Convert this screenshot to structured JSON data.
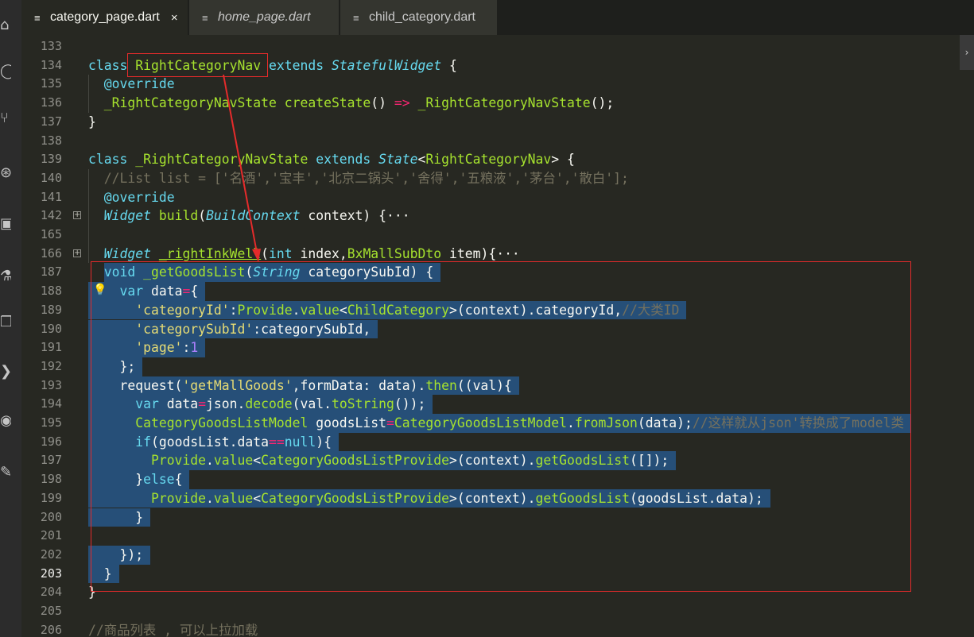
{
  "activity_bar": {
    "icons": [
      "files-icon",
      "search-icon",
      "source-control-icon",
      "debug-icon",
      "extensions-icon",
      "test-icon",
      "copy-icon",
      "run-icon",
      "settings-icon",
      "tools-icon"
    ]
  },
  "tabs": [
    {
      "label": "category_page.dart",
      "icon": "file-icon",
      "active": true,
      "close": "×"
    },
    {
      "label": "home_page.dart",
      "icon": "file-icon",
      "active": false,
      "italic": true
    },
    {
      "label": "child_category.dart",
      "icon": "file-icon",
      "active": false
    }
  ],
  "editor": {
    "lines": [
      {
        "no": "133",
        "code": ""
      },
      {
        "no": "134",
        "code": "class RightCategoryNav extends StatefulWidget {"
      },
      {
        "no": "135",
        "code": "  @override"
      },
      {
        "no": "136",
        "code": "  _RightCategoryNavState createState() => _RightCategoryNavState();"
      },
      {
        "no": "137",
        "code": "}"
      },
      {
        "no": "138",
        "code": ""
      },
      {
        "no": "139",
        "code": "class _RightCategoryNavState extends State<RightCategoryNav> {"
      },
      {
        "no": "140",
        "code": "  //List list = ['名酒','宝丰','北京二锅头','舍得','五粮液','茅台','散白'];"
      },
      {
        "no": "141",
        "code": "  @override"
      },
      {
        "no": "142",
        "code": "  Widget build(BuildContext context) {···",
        "fold": true
      },
      {
        "no": "165",
        "code": ""
      },
      {
        "no": "166",
        "code": "  Widget _rightInkWell(int index,BxMallSubDto item){···",
        "fold": true
      },
      {
        "no": "187",
        "code": "  void _getGoodsList(String categorySubId) {"
      },
      {
        "no": "188",
        "code": "    var data={"
      },
      {
        "no": "189",
        "code": "      'categoryId':Provide.value<ChildCategory>(context).categoryId,//大类ID"
      },
      {
        "no": "190",
        "code": "      'categorySubId':categorySubId,"
      },
      {
        "no": "191",
        "code": "      'page':1"
      },
      {
        "no": "192",
        "code": "    };"
      },
      {
        "no": "193",
        "code": "    request('getMallGoods',formData: data).then((val){"
      },
      {
        "no": "194",
        "code": "      var data=json.decode(val.toString());"
      },
      {
        "no": "195",
        "code": "      CategoryGoodsListModel goodsList=CategoryGoodsListModel.fromJson(data);//这样就从json'转换成了model类"
      },
      {
        "no": "196",
        "code": "      if(goodsList.data==null){"
      },
      {
        "no": "197",
        "code": "        Provide.value<CategoryGoodsListProvide>(context).getGoodsList([]);"
      },
      {
        "no": "198",
        "code": "      }else{"
      },
      {
        "no": "199",
        "code": "        Provide.value<CategoryGoodsListProvide>(context).getGoodsList(goodsList.data);"
      },
      {
        "no": "200",
        "code": "      }"
      },
      {
        "no": "201",
        "code": ""
      },
      {
        "no": "202",
        "code": "    });"
      },
      {
        "no": "203",
        "code": "  }",
        "current": true
      },
      {
        "no": "204",
        "code": "}"
      },
      {
        "no": "205",
        "code": ""
      },
      {
        "no": "206",
        "code": "//商品列表 , 可以上拉加载"
      }
    ]
  },
  "scrollbar": {
    "arrow": "›"
  }
}
